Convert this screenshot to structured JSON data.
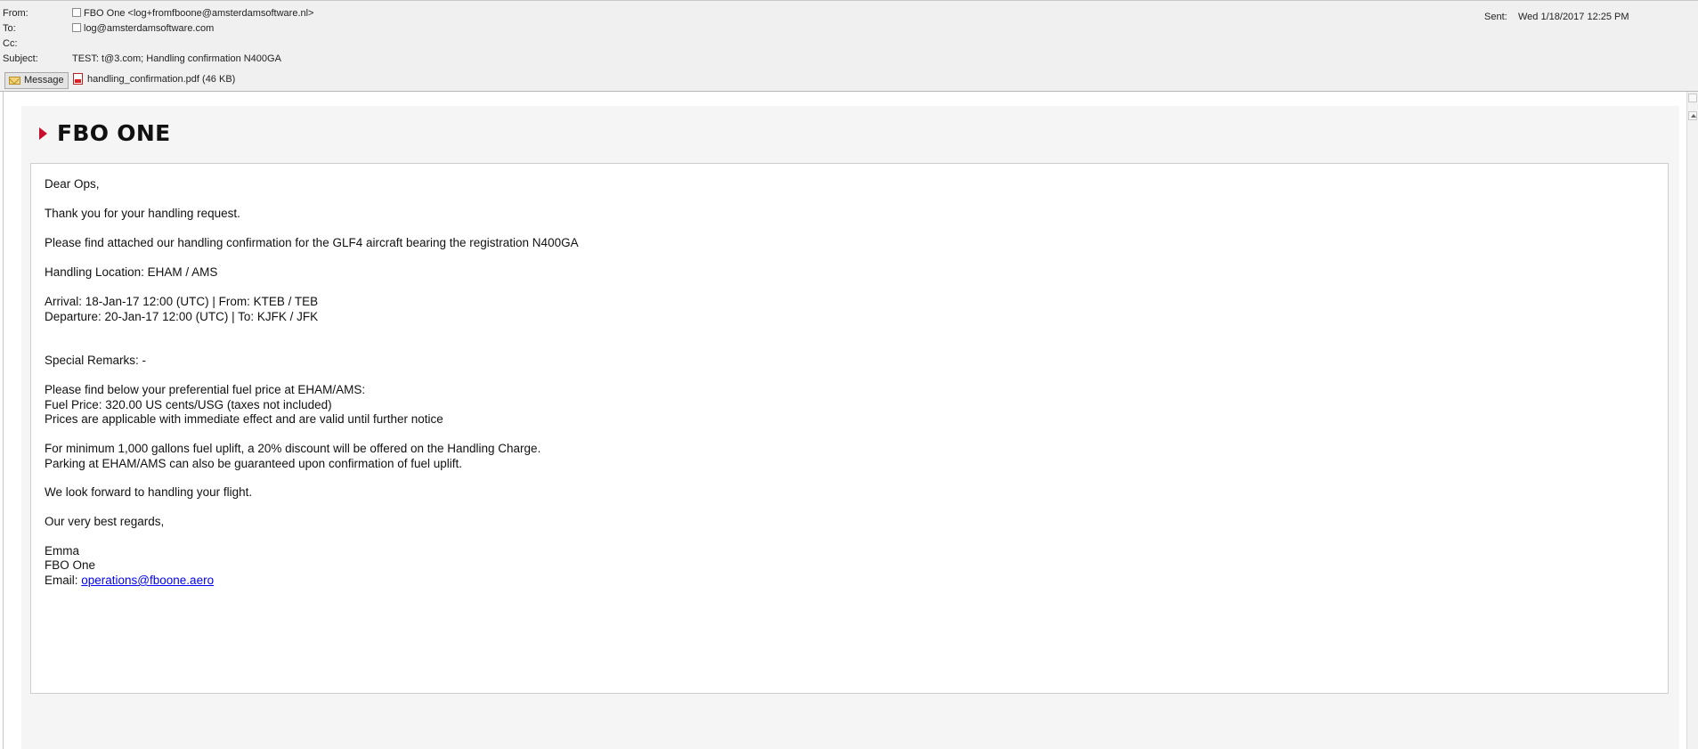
{
  "header": {
    "from_label": "From:",
    "from_value": "FBO One <log+fromfboone@amsterdamsoftware.nl>",
    "to_label": "To:",
    "to_value": "log@amsterdamsoftware.com",
    "cc_label": "Cc:",
    "cc_value": "",
    "subject_label": "Subject:",
    "subject_value": "TEST: t@3.com; Handling confirmation N400GA",
    "sent_label": "Sent:",
    "sent_value": "Wed 1/18/2017 12:25 PM"
  },
  "attachments": {
    "message_tab": "Message",
    "file": "handling_confirmation.pdf (46 KB)"
  },
  "logo": {
    "text": "FBO ONE",
    "accent_color": "#c8102e"
  },
  "email_body": {
    "greeting": "Dear Ops,",
    "thanks": "Thank you for your handling request.",
    "intro": "Please find attached our handling confirmation for the GLF4 aircraft bearing the registration N400GA",
    "location": "Handling Location: EHAM / AMS",
    "arrival": "Arrival: 18-Jan-17 12:00 (UTC) | From: KTEB / TEB",
    "departure": "Departure: 20-Jan-17 12:00 (UTC) | To: KJFK / JFK",
    "remarks": "Special Remarks: -",
    "fuel_intro": "Please find below your preferential fuel price at EHAM/AMS:",
    "fuel_price": "Fuel Price: 320.00 US cents/USG (taxes not included)",
    "fuel_validity": "Prices are applicable with immediate effect and are valid until further notice",
    "discount": "For minimum 1,000 gallons fuel uplift, a 20% discount will be offered on the Handling Charge.",
    "parking": "Parking at EHAM/AMS can also be guaranteed upon confirmation of fuel uplift.",
    "closing": "We look forward to handling your flight.",
    "regards": "Our very best regards,",
    "signature_name": "Emma",
    "signature_company": "FBO One",
    "email_label": "Email: ",
    "email_link": "operations@fboone.aero"
  }
}
